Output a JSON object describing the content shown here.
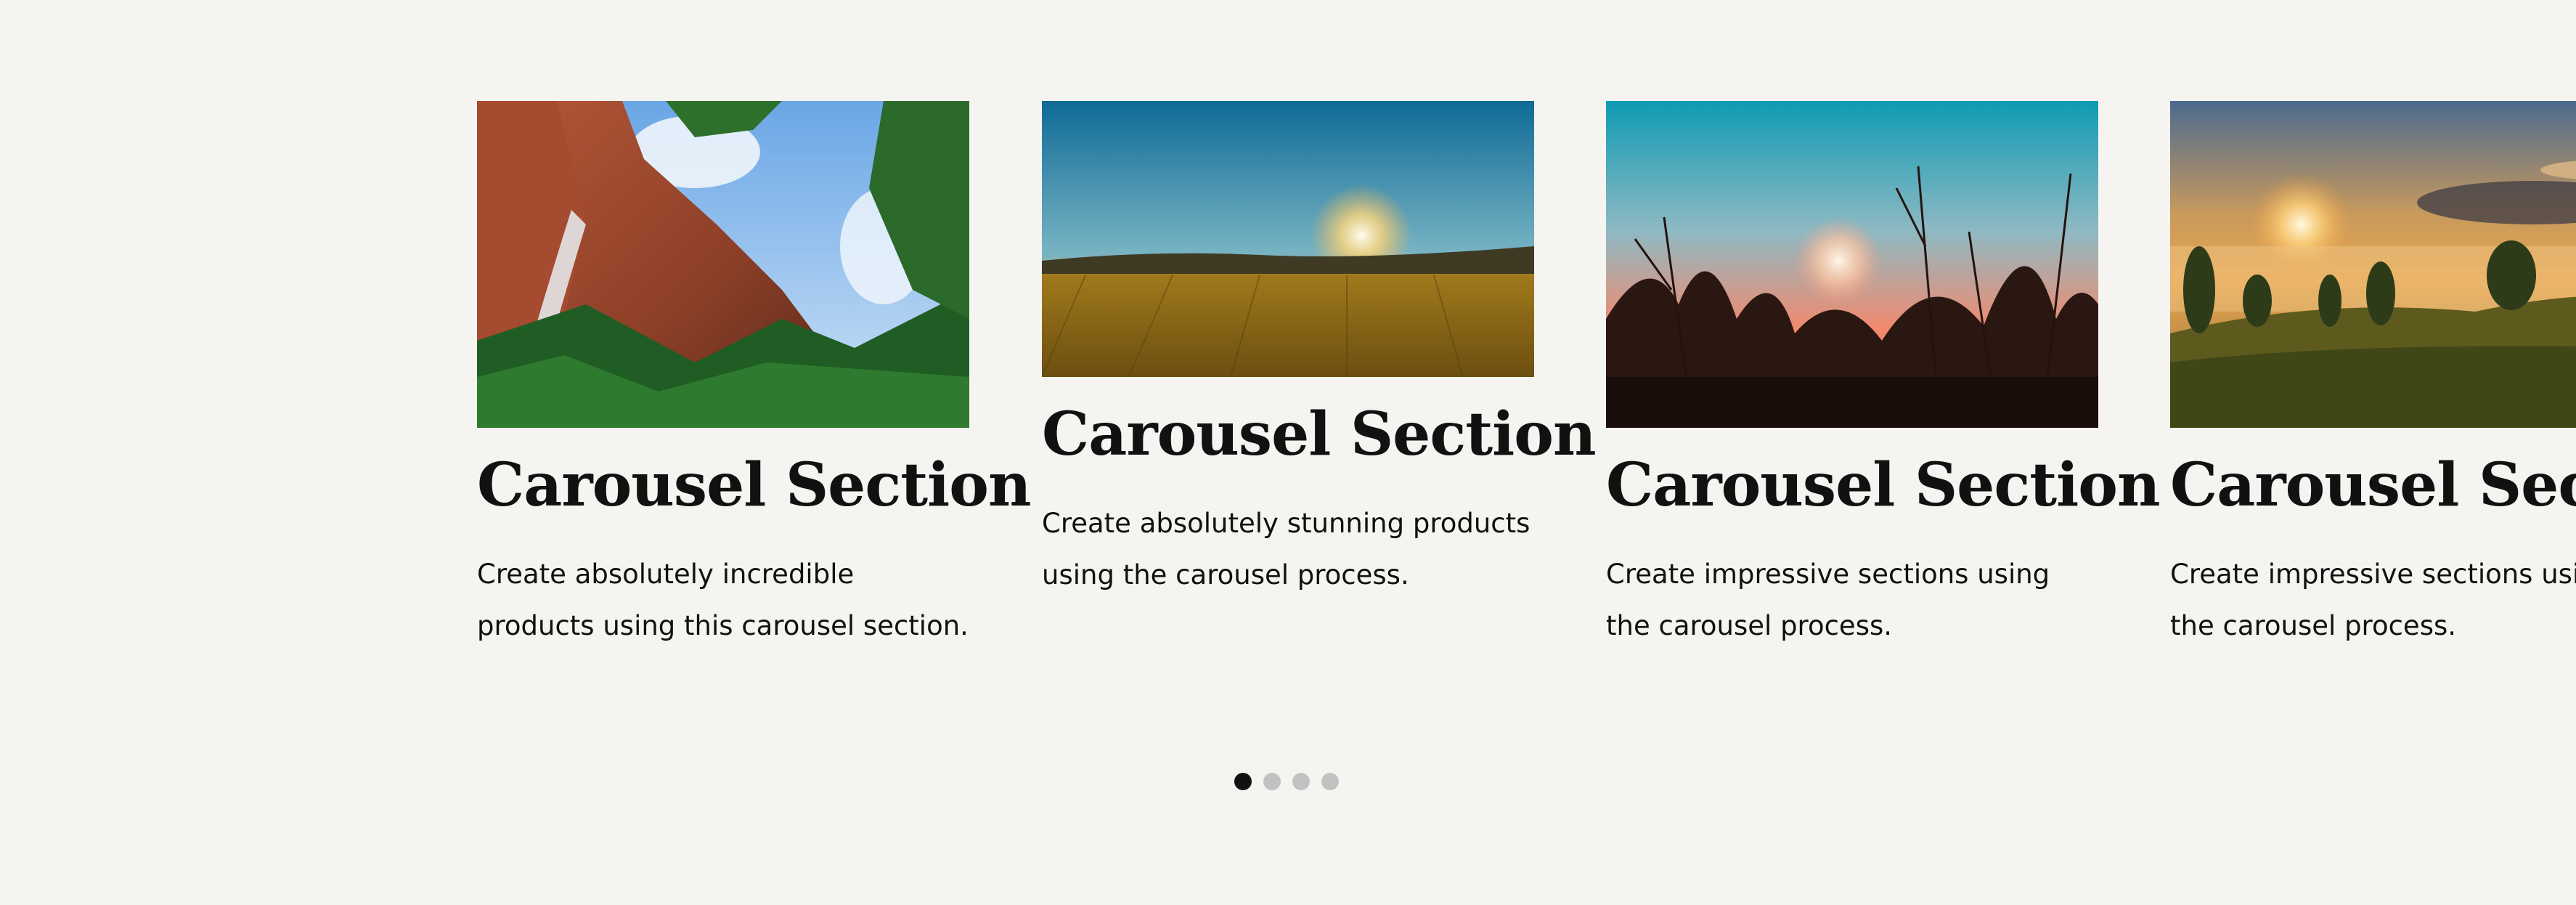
{
  "carousel": {
    "slides": [
      {
        "image": "waterfall-cliff-photo",
        "title": "Carousel Section",
        "description": "Create absolutely incredible products using this carousel section."
      },
      {
        "image": "wheat-field-sunset-photo",
        "title": "Carousel Section",
        "description": "Create absolutely stunning products using the carousel process."
      },
      {
        "image": "misty-sunrise-plants-photo",
        "title": "Carousel Section",
        "description": "Create impressive sections using the carousel process."
      },
      {
        "image": "foggy-meadow-sunrise-photo",
        "title": "Carousel Section",
        "description": "Create impressive sections using the carousel process."
      }
    ],
    "dots": {
      "count": 4,
      "active_index": 0
    }
  },
  "colors": {
    "background": "#f5f4f1",
    "text": "#111111",
    "dot_active": "#111111",
    "dot_inactive": "#c2c2c2"
  }
}
